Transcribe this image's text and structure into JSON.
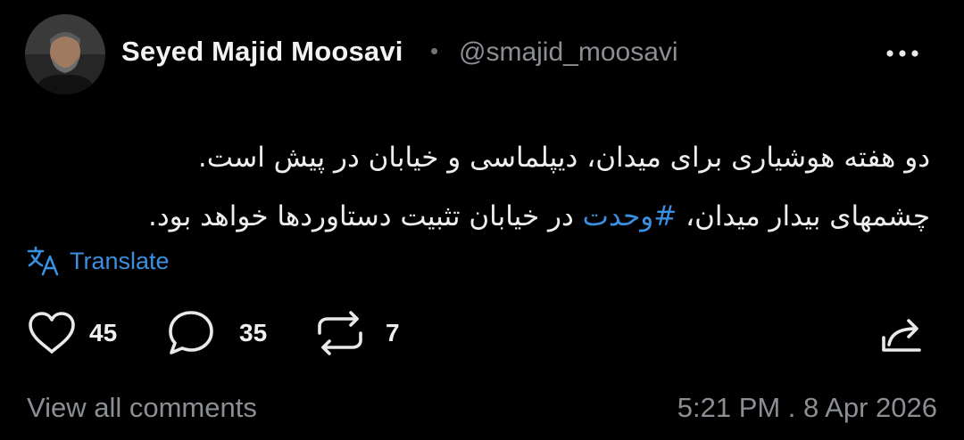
{
  "author": {
    "name": "Seyed Majid Moosavi",
    "separator": "•",
    "handle": "@smajid_moosavi"
  },
  "post": {
    "line1": "دو هفته هوشیاری برای میدان، دیپلماسی و خیابان در پیش است.",
    "line2_part1": "چشمهای بیدار میدان، ",
    "hashtag": "#وحدت",
    "line2_part2": " در خیابان تثبیت دستاوردها خواهد بود."
  },
  "translate_label": "Translate",
  "actions": {
    "likes": "45",
    "comments": "35",
    "reposts": "7"
  },
  "footer": {
    "view_comments": "View all comments",
    "timestamp": "5:21 PM . 8 Apr 2026"
  },
  "colors": {
    "background": "#000000",
    "accent": "#3b8fdf",
    "muted": "#8b8f94"
  },
  "icons": [
    "avatar",
    "more-icon",
    "translate-icon",
    "heart-icon",
    "comment-icon",
    "repost-icon",
    "share-icon"
  ]
}
